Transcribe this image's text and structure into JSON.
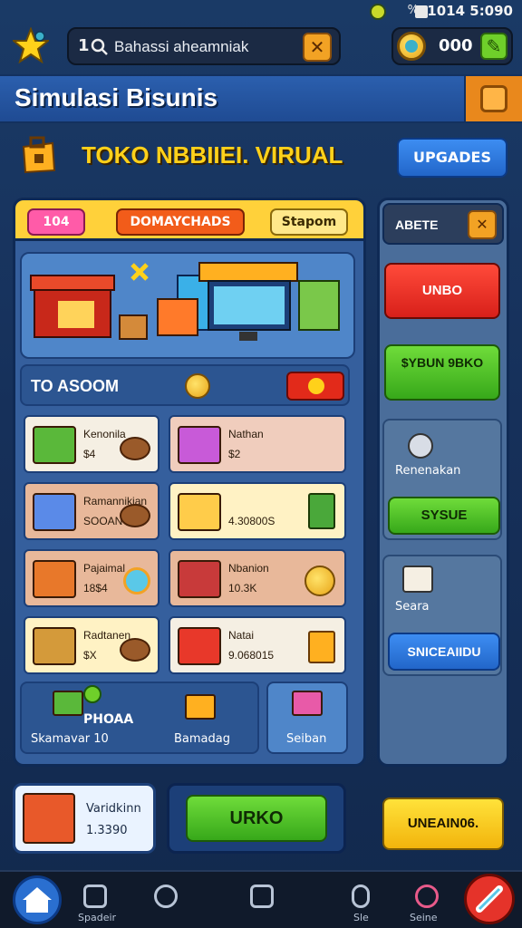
{
  "status_bar": {
    "time": "1014 5:090",
    "battery_text": "%"
  },
  "search": {
    "prefix": "1",
    "value": "Bahassi aheamniak"
  },
  "coins": {
    "amount": "000"
  },
  "app_title": "Simulasi Bisunis",
  "store": {
    "title": "TOKO NBBIIEI. VIRUAL",
    "upgrade_label": "UPGADES"
  },
  "panel_tabs": {
    "tab1": "104",
    "tab2": "DOMAYCHADS",
    "tab3": "Stapom"
  },
  "section": {
    "label": "TO ASOOM"
  },
  "items": [
    {
      "name": "Kenonila",
      "price": "$4"
    },
    {
      "name": "Nathan",
      "price": "$2"
    },
    {
      "name": "Ramannikian",
      "price": "SOOAN"
    },
    {
      "name": "",
      "price": "4.30800S"
    },
    {
      "name": "Pajaimal",
      "price": "18$4"
    },
    {
      "name": "Nbanion",
      "price": "10.3K"
    },
    {
      "name": "Radtanen",
      "price": "$X"
    },
    {
      "name": "Natai",
      "price": "9.068015"
    }
  ],
  "bottom_row": {
    "label_a": "PHOAA",
    "label_b": "Skamavar 10",
    "label_c": "Bamadag",
    "label_d": "Seiban"
  },
  "side": {
    "header": "ABETE",
    "red_button": "UNBO",
    "green_button": "$YBUN 9BKO",
    "card1_label": "Renenakan",
    "card1_button": "SYSUE",
    "card2_label": "Seara",
    "card2_button": "SNICEAIIDU",
    "yellow_button": "UNEAIN06."
  },
  "shop_card": {
    "name": "Varidkinn",
    "value": "1.3390"
  },
  "action_button": "URKO",
  "nav": {
    "item1": "Spadeir",
    "item2": "",
    "item3": "",
    "item4": "Sle",
    "item5": "Seine"
  },
  "colors": {
    "accent_yellow": "#ffd11a",
    "primary_blue": "#2266c9",
    "green": "#37a81a",
    "red": "#d8201a"
  }
}
